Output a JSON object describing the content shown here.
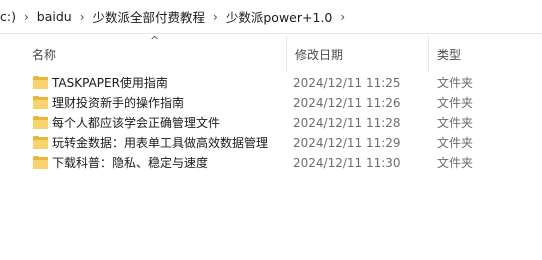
{
  "address": {
    "segments": [
      "c:)",
      "baidu",
      "少数派全部付费教程",
      "少数派power+1.0"
    ],
    "separator": "›"
  },
  "columns": {
    "name": "名称",
    "date": "修改日期",
    "type": "类型",
    "sort_indicator": "^"
  },
  "files": [
    {
      "name": "TASKPAPER使用指南",
      "date": "2024/12/11 11:25",
      "type": "文件夹",
      "icon": "folder-icon"
    },
    {
      "name": "理财投资新手的操作指南",
      "date": "2024/12/11 11:26",
      "type": "文件夹",
      "icon": "folder-icon"
    },
    {
      "name": "每个人都应该学会正确管理文件",
      "date": "2024/12/11 11:28",
      "type": "文件夹",
      "icon": "folder-icon"
    },
    {
      "name": "玩转金数据：用表单工具做高效数据管理",
      "date": "2024/12/11 11:29",
      "type": "文件夹",
      "icon": "folder-icon"
    },
    {
      "name": "下载科普：隐私、稳定与速度",
      "date": "2024/12/11 11:30",
      "type": "文件夹",
      "icon": "folder-icon"
    }
  ],
  "colors": {
    "folder": "#f8d471",
    "folder_back": "#e8b63a",
    "secondary_text": "#6d6d6d"
  }
}
